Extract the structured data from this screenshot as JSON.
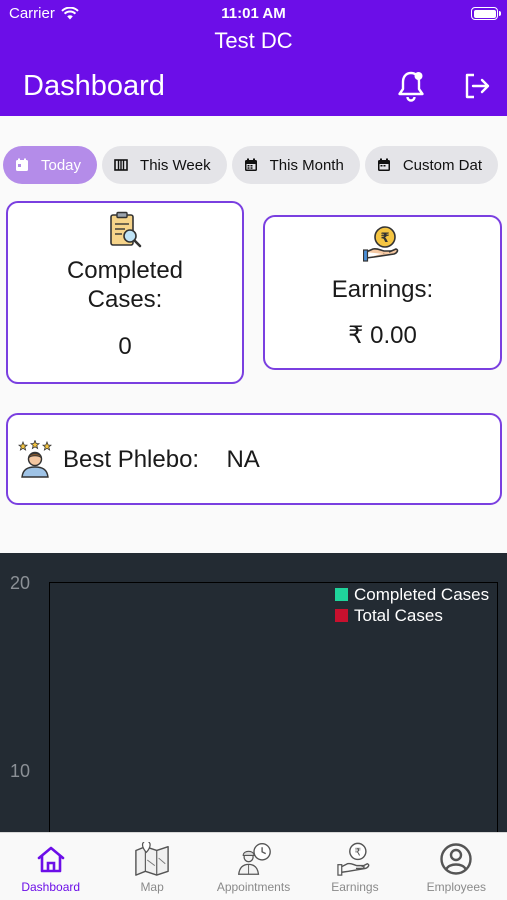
{
  "status_bar": {
    "carrier": "Carrier",
    "time": "11:01 AM"
  },
  "header": {
    "app_name": "Test DC",
    "title": "Dashboard"
  },
  "filters": [
    {
      "label": "Today",
      "icon": "calendar-icon",
      "active": true
    },
    {
      "label": "This Week",
      "icon": "week-icon",
      "active": false
    },
    {
      "label": "This Month",
      "icon": "calendar-icon",
      "active": false
    },
    {
      "label": "Custom Dat",
      "icon": "calendar-icon",
      "active": false
    }
  ],
  "cards": {
    "completed": {
      "label_line1": "Completed",
      "label_line2": "Cases:",
      "value": "0",
      "icon": "clipboard-search-icon"
    },
    "earnings": {
      "label": "Earnings:",
      "value": "₹ 0.00",
      "icon": "rupee-hand-icon"
    },
    "best_phlebo": {
      "label": "Best Phlebo:",
      "value": "NA",
      "icon": "star-person-icon"
    }
  },
  "chart_data": {
    "type": "bar",
    "y_ticks": [
      "20",
      "10"
    ],
    "series": [
      {
        "name": "Completed Cases",
        "color": "#1fd49b",
        "values": []
      },
      {
        "name": "Total Cases",
        "color": "#c8102e",
        "values": []
      }
    ],
    "legend_position": "top-right",
    "background": "#232b33"
  },
  "tabs": [
    {
      "label": "Dashboard",
      "icon": "home-icon",
      "active": true
    },
    {
      "label": "Map",
      "icon": "map-icon",
      "active": false
    },
    {
      "label": "Appointments",
      "icon": "appointments-icon",
      "active": false
    },
    {
      "label": "Earnings",
      "icon": "earnings-icon",
      "active": false
    },
    {
      "label": "Employees",
      "icon": "employees-icon",
      "active": false
    }
  ],
  "colors": {
    "primary": "#6c0ee8",
    "chip_active": "#b48ce9",
    "card_border": "#7a3fe0"
  }
}
